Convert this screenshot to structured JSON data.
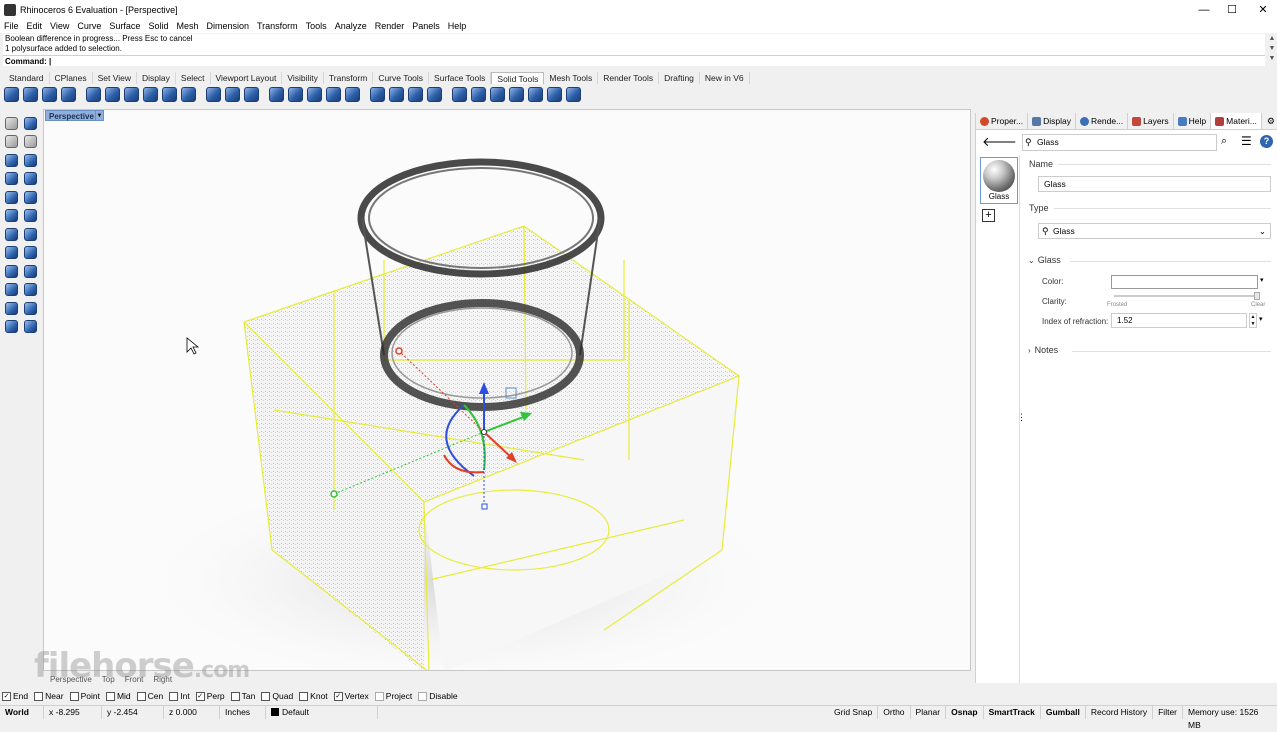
{
  "window": {
    "title": "Rhinoceros 6 Evaluation - [Perspective]",
    "controls": [
      "—",
      "☐",
      "✕"
    ]
  },
  "menu": [
    "File",
    "Edit",
    "View",
    "Curve",
    "Surface",
    "Solid",
    "Mesh",
    "Dimension",
    "Transform",
    "Tools",
    "Analyze",
    "Render",
    "Panels",
    "Help"
  ],
  "command": {
    "history": [
      "Boolean difference in progress... Press Esc to cancel",
      "1 polysurface added to selection."
    ],
    "prompt": "Command:"
  },
  "toolbar_tabs": {
    "items": [
      "Standard",
      "CPlanes",
      "Set View",
      "Display",
      "Select",
      "Viewport Layout",
      "Visibility",
      "Transform",
      "Curve Tools",
      "Surface Tools",
      "Solid Tools",
      "Mesh Tools",
      "Render Tools",
      "Drafting",
      "New in V6"
    ],
    "active": "Solid Tools"
  },
  "viewport": {
    "name": "Perspective",
    "bottom_tabs": [
      "Perspective",
      "Top",
      "Front",
      "Right"
    ]
  },
  "panel": {
    "tabs": [
      "Proper...",
      "Display",
      "Rende...",
      "Layers",
      "Help",
      "Materi..."
    ],
    "search_value": "Glass",
    "material_thumb_label": "Glass",
    "name_label": "Name",
    "name_value": "Glass",
    "type_label": "Type",
    "type_value": "Glass",
    "glass_section": "Glass",
    "color_label": "Color:",
    "clarity_label": "Clarity:",
    "clarity_left": "Frosted",
    "clarity_right": "Clear",
    "ior_label": "Index of refraction:",
    "ior_value": "1.52",
    "notes_section": "Notes"
  },
  "osnap": [
    {
      "label": "End",
      "checked": true
    },
    {
      "label": "Near",
      "checked": false
    },
    {
      "label": "Point",
      "checked": false
    },
    {
      "label": "Mid",
      "checked": false
    },
    {
      "label": "Cen",
      "checked": false
    },
    {
      "label": "Int",
      "checked": false
    },
    {
      "label": "Perp",
      "checked": true
    },
    {
      "label": "Tan",
      "checked": false
    },
    {
      "label": "Quad",
      "checked": false
    },
    {
      "label": "Knot",
      "checked": false
    },
    {
      "label": "Vertex",
      "checked": true
    },
    {
      "label": "Project",
      "checked": false
    },
    {
      "label": "Disable",
      "checked": false
    }
  ],
  "status": {
    "cplane": "World",
    "x": "x -8.295",
    "y": "y -2.454",
    "z": "z 0.000",
    "units": "Inches",
    "layer": "Default",
    "grid_snap": "Grid Snap",
    "ortho": "Ortho",
    "planar": "Planar",
    "osnap": "Osnap",
    "smarttrack": "SmartTrack",
    "gumball": "Gumball",
    "record_history": "Record History",
    "filter": "Filter",
    "memory": "Memory use: 1526 MB"
  },
  "watermark": {
    "main": "filehorse",
    "suffix": ".com"
  },
  "colors": {
    "selection_wire": "#e8ec3a",
    "viewport_label": "#8fb0dc",
    "accent": "#2f64ae"
  }
}
